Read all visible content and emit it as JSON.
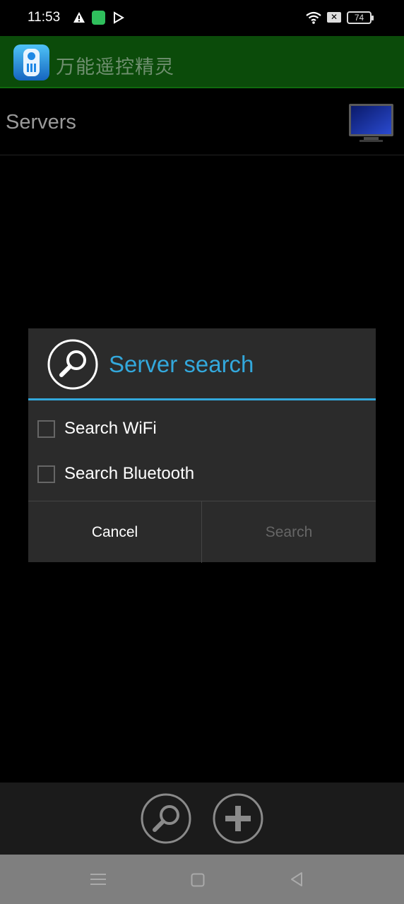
{
  "status_bar": {
    "time": "11:53",
    "battery": "74",
    "icons": [
      "warning-icon",
      "app-notification-icon",
      "play-store-icon",
      "wifi-icon",
      "no-sim-icon",
      "battery-icon"
    ]
  },
  "app_bar": {
    "title": "万能遥控精灵",
    "logo_icon": "remote-control-icon",
    "background_color": "#0b4b0a"
  },
  "servers": {
    "label": "Servers",
    "tv_icon": "tv-icon"
  },
  "dialog": {
    "title": "Server search",
    "title_color": "#33a8dc",
    "icon": "search-icon",
    "options": [
      {
        "label": "Search WiFi",
        "checked": false
      },
      {
        "label": "Search Bluetooth",
        "checked": false
      }
    ],
    "cancel_label": "Cancel",
    "search_label": "Search"
  },
  "bottom_bar": {
    "icons": [
      "search-icon",
      "add-icon"
    ]
  },
  "nav_bar": {
    "icons": [
      "menu-icon",
      "home-icon",
      "back-icon"
    ]
  }
}
